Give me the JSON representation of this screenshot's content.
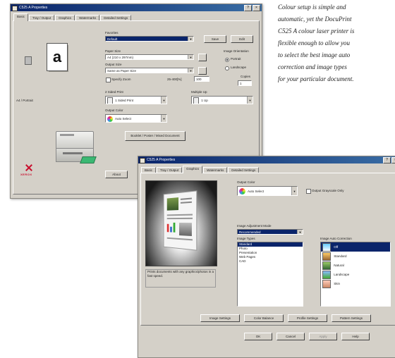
{
  "caption": {
    "lines": [
      "Colour setup is simple and",
      "automatic, yet the DocuPrint",
      "C525 A colour laser printer is",
      "flexible enough to allow you",
      "to select the best image auto",
      "correction and image types",
      "for your particular document."
    ]
  },
  "win1": {
    "title": "C525 A Properties",
    "tabs": [
      "Basic",
      "Tray / Output",
      "Graphics",
      "Watermarks",
      "Detailed Settings"
    ],
    "favorites_label": "Favorites",
    "favorites_value": "Default",
    "save_btn": "Save",
    "edit_btn": "Edit",
    "paper_size_label": "Paper Size",
    "paper_size_value": "A4 (210 x 297mm)",
    "output_size_label": "Output Size",
    "output_size_value": "Same as Paper Size",
    "orientation_label": "Image Orientation",
    "orientation_opts": [
      "Portrait",
      "Landscape"
    ],
    "zoom_label": "Specify Zoom",
    "zoom_range": "25-400[%]",
    "zoom_value": "100",
    "copies_label": "Copies",
    "copies_value": "1",
    "preview_letter": "a",
    "preview_caption": "A4 / Portrait",
    "duplex_label": "2 Sided Print",
    "duplex_value": "1 Sided Print",
    "multiup_label": "Multiple Up",
    "multiup_value": "1 Up",
    "output_color_label": "Output Color",
    "output_color_value": "Auto Select",
    "booklet_label": "Booklet / Poster / Mixed Document",
    "about_btn": "About",
    "logo_text": "XEROX"
  },
  "win2": {
    "title": "C525 A Properties",
    "tabs": [
      "Basic",
      "Tray / Output",
      "Graphics",
      "Watermarks",
      "Detailed Settings"
    ],
    "output_color_label": "Output Color",
    "output_color_value": "Auto Select",
    "output_grayscale_label": "Output Grayscale Only",
    "image_adjust_label": "Image Adjustment Mode",
    "image_adjust_value": "Recommended",
    "image_types_label": "Image Types",
    "image_types": [
      "Standard",
      "Photo",
      "Presentation",
      "Web Pages",
      "CAD"
    ],
    "auto_correction_label": "Image Auto Correction",
    "auto_correction_items": [
      "Off",
      "Standard",
      "Natural",
      "Landscape",
      "Skin"
    ],
    "preview_note": "Prints documents with any graphics/photos in a fast speed.",
    "bottom_buttons": [
      "Image Settings",
      "Color Balance",
      "Profile Settings",
      "Pattern Settings"
    ],
    "ok_btn": "OK",
    "cancel_btn": "Cancel",
    "apply_btn": "Apply",
    "help_btn": "Help"
  }
}
